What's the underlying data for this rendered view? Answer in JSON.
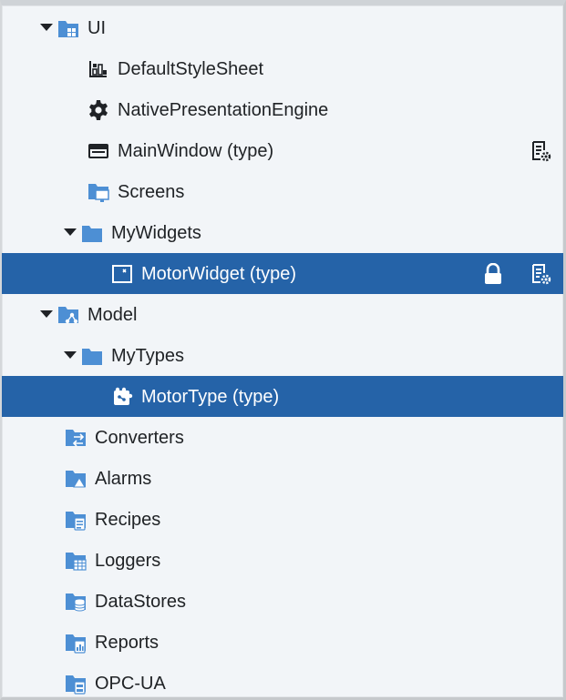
{
  "tree": {
    "ui": {
      "label": "UI",
      "icon": "ui-folder-icon"
    },
    "default_style_sheet": {
      "label": "DefaultStyleSheet",
      "icon": "style-sheet-icon"
    },
    "native_presentation_engine": {
      "label": "NativePresentationEngine",
      "icon": "gear-icon"
    },
    "main_window": {
      "label": "MainWindow (type)",
      "icon": "window-icon",
      "trailing_icon": "type-settings-icon"
    },
    "screens": {
      "label": "Screens",
      "icon": "screens-folder-icon"
    },
    "my_widgets": {
      "label": "MyWidgets",
      "icon": "folder-icon"
    },
    "motor_widget": {
      "label": "MotorWidget (type)",
      "icon": "widget-icon",
      "trailing_icons": [
        "lock-icon",
        "type-settings-icon"
      ]
    },
    "model": {
      "label": "Model",
      "icon": "model-folder-icon"
    },
    "my_types": {
      "label": "MyTypes",
      "icon": "folder-icon"
    },
    "motor_type": {
      "label": "MotorType (type)",
      "icon": "object-type-icon"
    },
    "converters": {
      "label": "Converters",
      "icon": "converters-folder-icon"
    },
    "alarms": {
      "label": "Alarms",
      "icon": "alarms-folder-icon"
    },
    "recipes": {
      "label": "Recipes",
      "icon": "recipes-folder-icon"
    },
    "loggers": {
      "label": "Loggers",
      "icon": "loggers-folder-icon"
    },
    "data_stores": {
      "label": "DataStores",
      "icon": "datastores-folder-icon"
    },
    "reports": {
      "label": "Reports",
      "icon": "reports-folder-icon"
    },
    "opc_ua": {
      "label": "OPC-UA",
      "icon": "opcua-folder-icon"
    }
  },
  "colors": {
    "selection": "#2563a8",
    "folder": "#4d8fd4",
    "panel_background": "#f2f5f8",
    "text": "#202326"
  }
}
